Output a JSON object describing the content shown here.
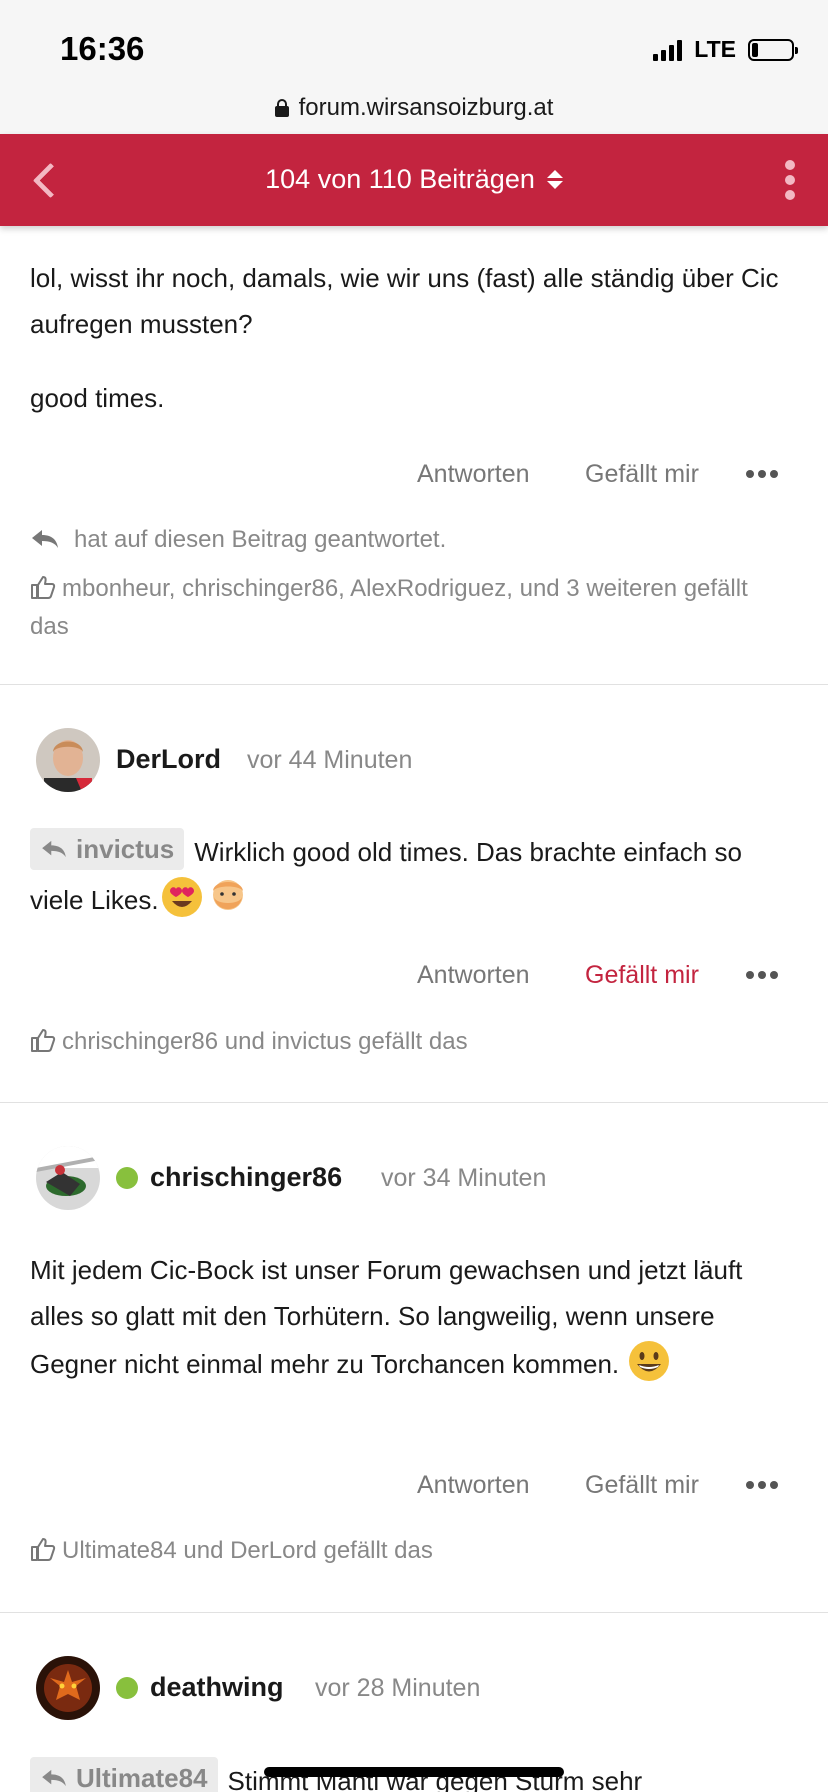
{
  "status_bar": {
    "time": "16:36",
    "network": "LTE",
    "battery_level": 0.15
  },
  "browser": {
    "url": "forum.wirsansoizburg.at"
  },
  "header": {
    "title": "104 von 110 Beiträgen"
  },
  "posts": [
    {
      "paragraphs": [
        "lol, wisst ihr noch, damals, wie wir uns (fast) alle ständig über Cic aufregen mussten?",
        "good times."
      ],
      "actions": {
        "reply": "Antworten",
        "like": "Gefällt mir"
      },
      "reply_note": "hat auf diesen Beitrag geantwortet.",
      "likes": "mbonheur, chrischinger86, AlexRodriguez, und 3 weiteren gefällt das"
    },
    {
      "author": "DerLord",
      "time": "vor 44 Minuten",
      "quote": "invictus",
      "text": "Wirklich good old times. Das brachte einfach so viele Likes.",
      "emojis": [
        "heart-eyes-emoji",
        "bearded-face-emoji"
      ],
      "actions": {
        "reply": "Antworten",
        "like": "Gefällt mir"
      },
      "liked_by_me": true,
      "likes": "chrischinger86 und invictus gefällt das"
    },
    {
      "author": "chrischinger86",
      "online": true,
      "time": "vor 34 Minuten",
      "text": "Mit jedem Cic-Bock ist unser Forum gewachsen und jetzt läuft alles so glatt mit den Torhütern. So langweilig, wenn unsere Gegner nicht einmal mehr zu Torchancen kommen.",
      "emojis": [
        "grinning-face-emoji"
      ],
      "actions": {
        "reply": "Antworten",
        "like": "Gefällt mir"
      },
      "likes": "Ultimate84 und DerLord gefällt das"
    },
    {
      "author": "deathwing",
      "online": true,
      "time": "vor 28 Minuten",
      "quote": "Ultimate84",
      "text": "Stimmt Manti war gegen Sturm sehr"
    }
  ],
  "colors": {
    "brand": "#c3243f",
    "online": "#88c03d",
    "muted": "#888888"
  }
}
